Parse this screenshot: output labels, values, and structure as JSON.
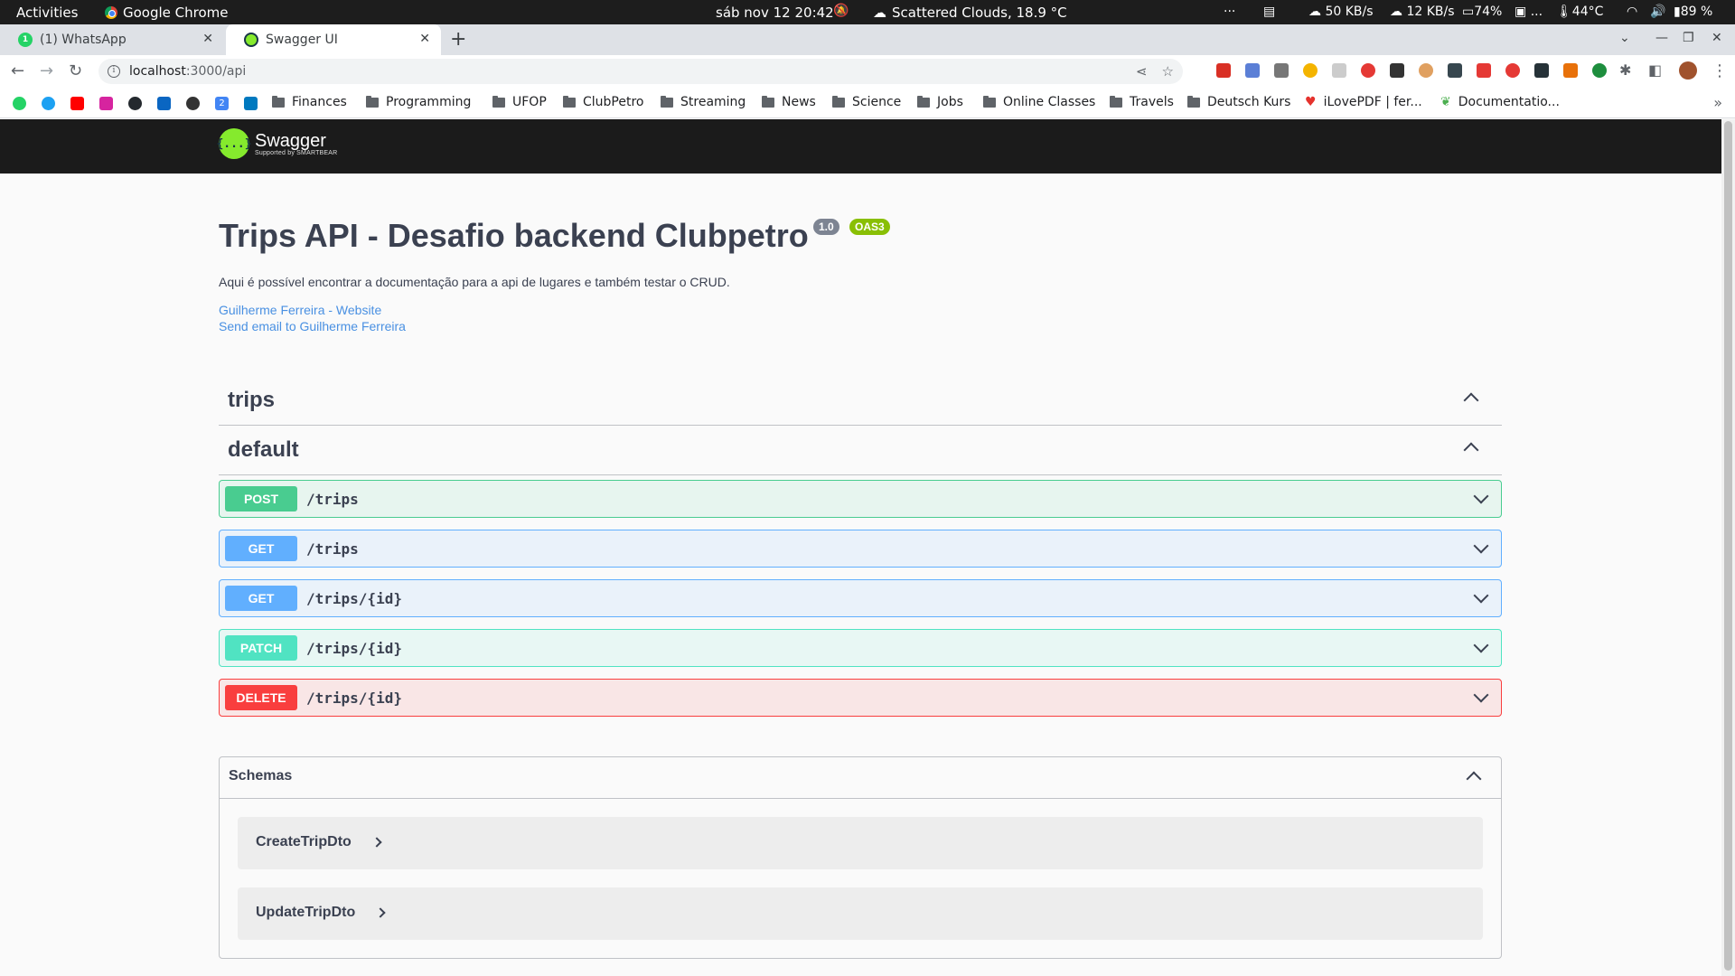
{
  "os": {
    "activities": "Activities",
    "app": "Google Chrome",
    "clock": "sáb nov 12  20:42",
    "weather": "Scattered Clouds, 18.9 °C",
    "tray": {
      "dots": "···",
      "down": "50 KB/s",
      "up": "12 KB/s",
      "battery_short": "74%",
      "disk": "...",
      "temp": "44°C",
      "battery": "89 %"
    }
  },
  "browser": {
    "tabs": [
      {
        "label": "(1) WhatsApp",
        "active": false
      },
      {
        "label": "Swagger UI",
        "active": true
      }
    ],
    "url_host": "localhost",
    "url_path": ":3000/api",
    "bookmarks": [
      "Finances",
      "Programming",
      "UFOP",
      "ClubPetro",
      "Streaming",
      "News",
      "Science",
      "Jobs",
      "Online Classes",
      "Travels",
      "Deutsch Kurs"
    ],
    "bookmark_ilovepdf": "iLovePDF | fer...",
    "bookmark_docs": "Documentatio...",
    "bookmark_icon_letter": "2"
  },
  "swagger": {
    "brand": "Swagger",
    "brand_sub": "Supported by SMARTBEAR",
    "logo_glyph": "{...}",
    "title": "Trips API - Desafio backend Clubpetro",
    "version": "1.0",
    "oas": "OAS3",
    "description": "Aqui é possível encontrar a documentação para a api de lugares e também testar o CRUD.",
    "links": [
      "Guilherme Ferreira - Website",
      "Send email to Guilherme Ferreira"
    ],
    "tags": [
      "trips",
      "default"
    ],
    "operations": [
      {
        "method": "POST",
        "path": "/trips"
      },
      {
        "method": "GET",
        "path": "/trips"
      },
      {
        "method": "GET",
        "path": "/trips/{id}"
      },
      {
        "method": "PATCH",
        "path": "/trips/{id}"
      },
      {
        "method": "DELETE",
        "path": "/trips/{id}"
      }
    ],
    "schemas_title": "Schemas",
    "schemas": [
      "CreateTripDto",
      "UpdateTripDto"
    ]
  }
}
